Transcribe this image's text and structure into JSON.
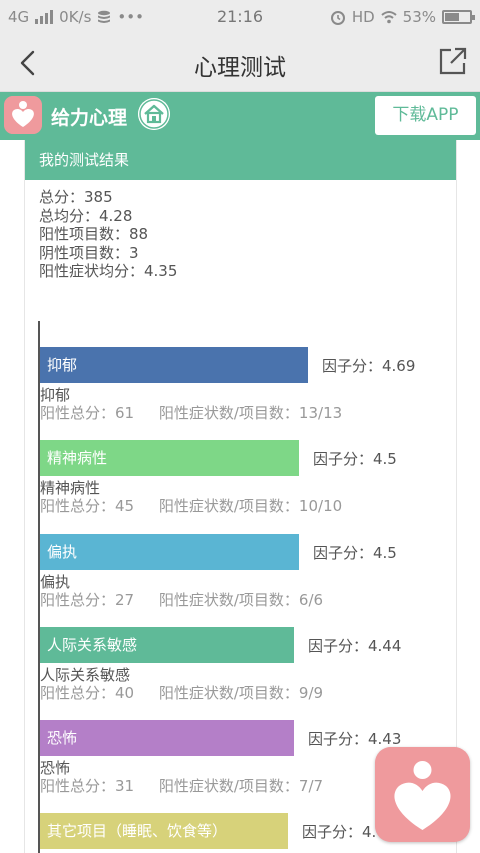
{
  "status_bar": {
    "network": "4G",
    "speed": "0K/s",
    "time": "21:16",
    "hd": "HD",
    "battery": "53%"
  },
  "nav": {
    "title": "心理测试"
  },
  "brand": {
    "name": "给力心理",
    "download": "下载APP"
  },
  "result": {
    "header": "我的测试结果",
    "total": "总分：385",
    "average": "总均分：4.28",
    "positive_items": "阳性项目数：88",
    "negative_items": "阴性项目数：3",
    "positive_avg": "阳性症状均分：4.35"
  },
  "factors": [
    {
      "name": "抑郁",
      "score": "因子分：4.69",
      "positive_total": "阳性总分：61",
      "ratio": "阳性症状数/项目数：13/13",
      "color": "#4a73ad",
      "bar_fraction": 0.95
    },
    {
      "name": "精神病性",
      "score": "因子分：4.5",
      "positive_total": "阳性总分：45",
      "ratio": "阳性症状数/项目数：10/10",
      "color": "#7ed787",
      "bar_fraction": 0.92
    },
    {
      "name": "偏执",
      "score": "因子分：4.5",
      "positive_total": "阳性总分：27",
      "ratio": "阳性症状数/项目数：6/6",
      "color": "#5ab5d3",
      "bar_fraction": 0.92
    },
    {
      "name": "人际关系敏感",
      "score": "因子分：4.44",
      "positive_total": "阳性总分：40",
      "ratio": "阳性症状数/项目数：9/9",
      "color": "#5fba98",
      "bar_fraction": 0.9
    },
    {
      "name": "恐怖",
      "score": "因子分：4.43",
      "positive_total": "阳性总分：31",
      "ratio": "阳性症状数/项目数：7/7",
      "color": "#b47fc8",
      "bar_fraction": 0.9
    },
    {
      "name": "其它项目（睡眠、饮食等）",
      "score": "因子分：4.",
      "color": "#d7d27a",
      "bar_fraction": 0.88
    }
  ]
}
